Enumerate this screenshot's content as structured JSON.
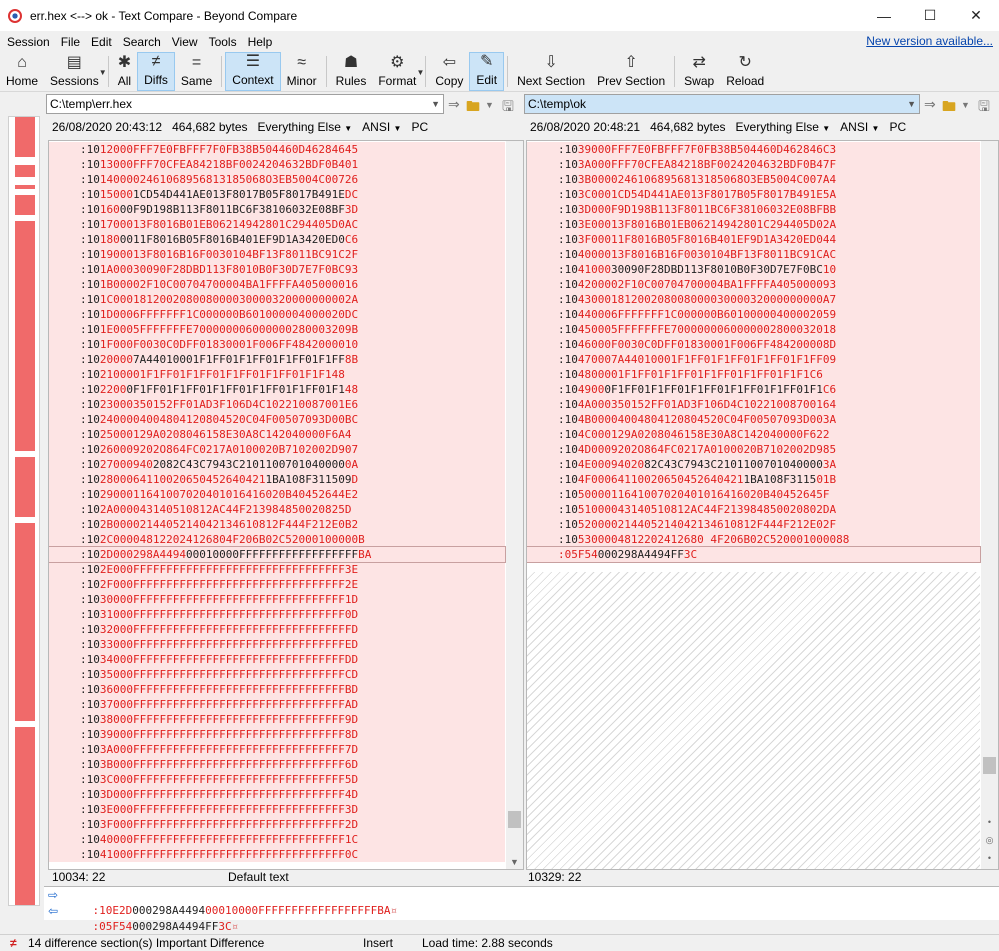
{
  "window": {
    "title": "err.hex <--> ok - Text Compare - Beyond Compare"
  },
  "menu": [
    "Session",
    "File",
    "Edit",
    "Search",
    "View",
    "Tools",
    "Help"
  ],
  "new_version": "New version available...",
  "toolbar": [
    {
      "label": "Home",
      "icon": "home-icon",
      "glyph": "⌂",
      "dd": false,
      "active": false
    },
    {
      "label": "Sessions",
      "icon": "sessions-icon",
      "glyph": "▤",
      "dd": true,
      "active": false
    },
    {
      "sep": true
    },
    {
      "label": "All",
      "icon": "all-icon",
      "glyph": "✱",
      "dd": false,
      "active": false
    },
    {
      "label": "Diffs",
      "icon": "diffs-icon",
      "glyph": "≠",
      "dd": false,
      "active": true
    },
    {
      "label": "Same",
      "icon": "same-icon",
      "glyph": "=",
      "dd": false,
      "active": false
    },
    {
      "sep": true
    },
    {
      "label": "Context",
      "icon": "context-icon",
      "glyph": "☰",
      "dd": false,
      "active": true
    },
    {
      "label": "Minor",
      "icon": "minor-icon",
      "glyph": "≈",
      "dd": false,
      "active": false
    },
    {
      "sep": true
    },
    {
      "label": "Rules",
      "icon": "rules-icon",
      "glyph": "☗",
      "dd": false,
      "active": false
    },
    {
      "label": "Format",
      "icon": "format-icon",
      "glyph": "⚙",
      "dd": true,
      "active": false
    },
    {
      "sep": true
    },
    {
      "label": "Copy",
      "icon": "copy-icon",
      "glyph": "⇦",
      "dd": false,
      "active": false
    },
    {
      "label": "Edit",
      "icon": "edit-icon",
      "glyph": "✎",
      "dd": false,
      "active": true
    },
    {
      "sep": true
    },
    {
      "label": "Next Section",
      "icon": "next-section-icon",
      "glyph": "⇩",
      "dd": false,
      "active": false
    },
    {
      "label": "Prev Section",
      "icon": "prev-section-icon",
      "glyph": "⇧",
      "dd": false,
      "active": false
    },
    {
      "sep": true
    },
    {
      "label": "Swap",
      "icon": "swap-icon",
      "glyph": "⇄",
      "dd": false,
      "active": false
    },
    {
      "label": "Reload",
      "icon": "reload-icon",
      "glyph": "↻",
      "dd": false,
      "active": false
    }
  ],
  "left": {
    "path": "C:\\temp\\err.hex",
    "date": "26/08/2020 20:43:12",
    "size": "464,682 bytes",
    "filter": "Everything Else",
    "encoding": "ANSI",
    "eol": "PC",
    "position": "10034: 22",
    "text_format": "Default text",
    "lines": [
      [
        "12000FFF7E0FBFFF7F0FB38B504460D462846",
        "45"
      ],
      [
        "13000FFF70CFEA84218BF0024204632BDF0B4",
        "01"
      ],
      [
        "1400002461068956813185068O3EB5004C007",
        "26"
      ],
      [
        "15000",
        "1CD54D441AE013F8017B05F8017B491E",
        "DC"
      ],
      [
        "160",
        "00F9D198B113F8011BC6F38106032E08BF",
        "3D"
      ],
      [
        "1700013F8016B01EB06214942801C294405D0A",
        "C"
      ],
      [
        "180",
        "0011F8016B05F8016B401EF9D1A3420ED0",
        "C6"
      ],
      [
        "1900013F8016B16F0030104BF13F8011BC91",
        "C2F"
      ],
      [
        "1A00030090F28DBD113F8010B0F30D7E7F0BC",
        "93"
      ],
      [
        "1B00002F10C00704700004BA1FFFFA405000",
        "016"
      ],
      [
        "1C0001812002080080000300003200000000",
        "02A"
      ],
      [
        "1D0006FFFFFFF1C000000B6010000040000",
        "20DC"
      ],
      [
        "1E0005FFFFFFFE70000000600000028000320",
        "9B"
      ],
      [
        "1F000F0030C0DFF01830001F006FF48420000",
        "10"
      ],
      [
        "20000",
        "7A44010001F1FF01F1FF01F1FF01F1FF",
        "8B"
      ],
      [
        "2100001F1FF01F1FF01F1FF01F1FF01F1F1",
        "48"
      ],
      [
        "2200",
        "0F1FF01F1FF01F1FF01F1FF01F1FF01F1",
        "48"
      ],
      [
        "23000350152FF01AD3F106D4C1022100870",
        "01E6"
      ],
      [
        "2400004004804120804520C04F00507093D0",
        "0BC"
      ],
      [
        "25000129A0208046158E30A8C1420400",
        "00F6A4"
      ],
      [
        "260009202O864FC0217A0100020B7102002D9",
        "07"
      ],
      [
        "27000940",
        "2082C43C7943C2101100701040000",
        "0A"
      ],
      [
        "2800064110020650452640421",
        "1BA108F311509",
        "D"
      ],
      [
        "2900011641007020401016416020B40452644",
        "E2"
      ],
      [
        "2A000043140510812AC44F21398485002",
        "0825D"
      ],
      [
        "2B0000214405214042134610812F444F212E0",
        "B2"
      ],
      [
        "2C000048122024126804F206B02C5200010000",
        "0B"
      ],
      [
        "2D000298A4494",
        "00010000FFFFFFFFFFFFFFFFFF",
        "BA"
      ],
      [
        "2E000FFFFFFFFFFFFFFFFFFFFFFFFFFFFFFFF",
        "3E"
      ],
      [
        "2F000FFFFFFFFFFFFFFFFFFFFFFFFFFFFFFFF",
        "2E"
      ],
      [
        "30000FFFFFFFFFFFFFFFFFFFFFFFFFFFFFFFF",
        "1D"
      ],
      [
        "31000FFFFFFFFFFFFFFFFFFFFFFFFFFFFFFFF",
        "0D"
      ],
      [
        "32000FFFFFFFFFFFFFFFFFFFFFFFFFFFFFFFF",
        "FD"
      ],
      [
        "33000FFFFFFFFFFFFFFFFFFFFFFFFFFFFFFFF",
        "ED"
      ],
      [
        "34000FFFFFFFFFFFFFFFFFFFFFFFFFFFFFFFF",
        "DD"
      ],
      [
        "35000FFFFFFFFFFFFFFFFFFFFFFFFFFFFFFFF",
        "CD"
      ],
      [
        "36000FFFFFFFFFFFFFFFFFFFFFFFFFFFFFFFF",
        "BD"
      ],
      [
        "37000FFFFFFFFFFFFFFFFFFFFFFFFFFFFFFFF",
        "AD"
      ],
      [
        "38000FFFFFFFFFFFFFFFFFFFFFFFFFFFFFFFF",
        "9D"
      ],
      [
        "39000FFFFFFFFFFFFFFFFFFFFFFFFFFFFFFFF",
        "8D"
      ],
      [
        "3A000FFFFFFFFFFFFFFFFFFFFFFFFFFFFFFFF",
        "7D"
      ],
      [
        "3B000FFFFFFFFFFFFFFFFFFFFFFFFFFFFFFFF",
        "6D"
      ],
      [
        "3C000FFFFFFFFFFFFFFFFFFFFFFFFFFFFFFFF",
        "5D"
      ],
      [
        "3D000FFFFFFFFFFFFFFFFFFFFFFFFFFFFFFFF",
        "4D"
      ],
      [
        "3E000FFFFFFFFFFFFFFFFFFFFFFFFFFFFFFFF",
        "3D"
      ],
      [
        "3F000FFFFFFFFFFFFFFFFFFFFFFFFFFFFFFFF",
        "2D"
      ],
      [
        "40000FFFFFFFFFFFFFFFFFFFFFFFFFFFFFFFF",
        "1C"
      ],
      [
        "41000FFFFFFFFFFFFFFFFFFFFFFFFFFFFFFFF",
        "0C"
      ]
    ]
  },
  "right": {
    "path": "C:\\temp\\ok",
    "date": "26/08/2020 20:48:21",
    "size": "464,682 bytes",
    "filter": "Everything Else",
    "encoding": "ANSI",
    "eol": "PC",
    "position": "10329: 22",
    "lines": [
      [
        "39000FFF7E0FBFFF7F0FB38B504460D462846",
        "C3"
      ],
      [
        "3A000FFF70CFEA84218BF0024204632BDF0B4",
        "7F"
      ],
      [
        "3B00002461068956813185068O3EB5004C007",
        "A4"
      ],
      [
        "3C0001CD54D441AE013F8017B05F8017B491E",
        "5A"
      ],
      [
        "3D000F9D198B113F8011BC6F38106032E08BF",
        "BB"
      ],
      [
        "3E00013F8016B01EB06214942801C294405D0",
        "2A"
      ],
      [
        "3F00011F8016B05F8016B401EF9D1A3420ED0",
        "44"
      ],
      [
        "4000013F8016B16F0030104BF13F8011BC91",
        "CAC"
      ],
      [
        "41000",
        "30090F28DBD113F8010B0F30D7E7F0BC",
        "10"
      ],
      [
        "4200002F10C00704700004BA1FFFFA40500009",
        "3"
      ],
      [
        "4300018120020800800003000032000000000",
        "A7"
      ],
      [
        "440006FFFFFFF1C000000B601000004000020",
        "59"
      ],
      [
        "450005FFFFFFFE70000000600000028000320",
        "18"
      ],
      [
        "46000F0030C0DFF01830001F006FF48420000",
        "8D"
      ],
      [
        "470007A44010001F1FF01F1FF01F1FF01F1FF",
        "09"
      ],
      [
        "4800001F1FF01F1FF01F1FF01F1FF01F1F1",
        "C6"
      ],
      [
        "4900",
        "0F1FF01F1FF01F1FF01F1FF01F1FF01F1",
        "C6"
      ],
      [
        "4A000350152FF01AD3F106D4C10221008700",
        "164"
      ],
      [
        "4B00004004804120804520C04F00507093D0",
        "03A"
      ],
      [
        "4C000129A0208046158E30A8C1420400",
        "00F622"
      ],
      [
        "4D0009202O864FC0217A0100020B7102002D",
        "985"
      ],
      [
        "4E00094020",
        "82C43C7943C2101100701040000",
        "3A"
      ],
      [
        "4F00064110020650452640421",
        "1BA108F3115",
        "01B"
      ],
      [
        "5000011641007020401016416020B40452645",
        "F"
      ],
      [
        "51000043140510812AC44F21398485002",
        "0802DA"
      ],
      [
        "520000214405214042134610812F444F212E0",
        "2F"
      ],
      [
        "5300004812202412680 4F206B02C52000100008",
        "8"
      ]
    ],
    "last_line": [
      "05F54",
      "000298A4494FF",
      "3C"
    ]
  },
  "bottom": {
    "left_line": [
      "10E2D",
      "000298A4494",
      "00010000FFFFFFFFFFFFFFFFFFBA",
      "¤"
    ],
    "right_line": [
      "05F54",
      "000298A4494FF",
      "3C",
      "¤"
    ]
  },
  "status": {
    "sections": "14 difference section(s) Important Difference",
    "mode": "Insert",
    "load_time": "Load time: 2.88 seconds"
  }
}
